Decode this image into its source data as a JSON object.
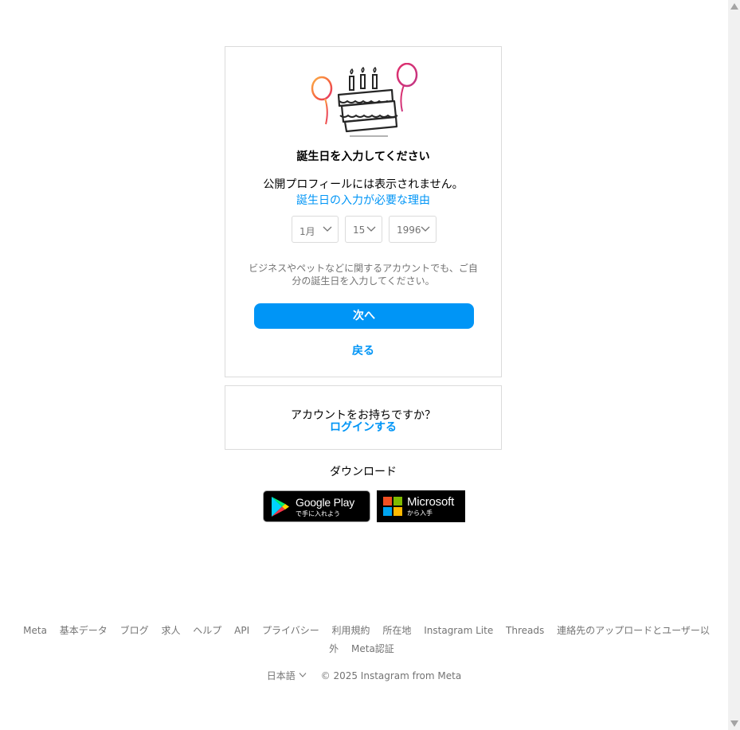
{
  "birthday_card": {
    "title": "誕生日を入力してください",
    "subtitle": "公開プロフィールには表示されません。",
    "why_link": "誕生日の入力が必要な理由",
    "month": {
      "selected": "1月"
    },
    "day": {
      "selected": "15"
    },
    "year": {
      "selected": "1996"
    },
    "note": "ビジネスやペットなどに関するアカウントでも、ご自分の誕生日を入力してください。",
    "next_label": "次へ",
    "back_label": "戻る"
  },
  "login_card": {
    "question": "アカウントをお持ちですか？",
    "login_label": "ログインする"
  },
  "download": {
    "label": "ダウンロード",
    "google_play": {
      "big": "Google Play",
      "small": "で手に入れよう"
    },
    "microsoft": {
      "big": "Microsoft",
      "small": "から入手"
    }
  },
  "footer": {
    "links": [
      "Meta",
      "基本データ",
      "ブログ",
      "求人",
      "ヘルプ",
      "API",
      "プライバシー",
      "利用規約",
      "所在地",
      "Instagram Lite",
      "Threads",
      "連絡先のアップロードとユーザー以外",
      "Meta認証"
    ],
    "language": "日本語",
    "copyright": "© 2025 Instagram from Meta"
  },
  "colors": {
    "accent": "#0095f6",
    "border": "#dbdbdb",
    "muted_text": "#737373"
  }
}
